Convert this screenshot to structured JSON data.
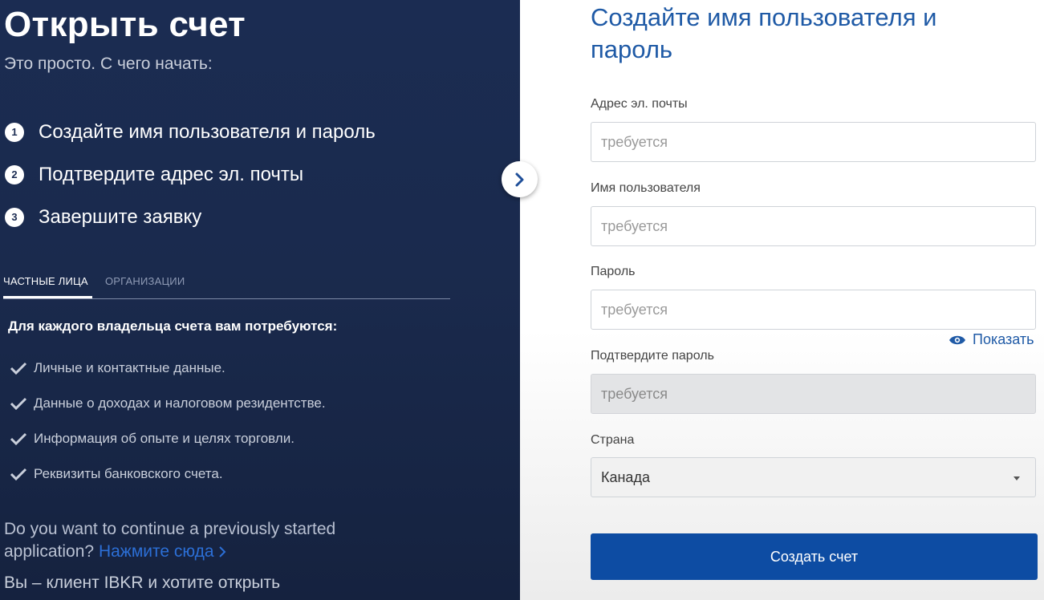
{
  "left": {
    "title": "Открыть счет",
    "subtitle": "Это просто. С чего начать:",
    "steps": [
      {
        "num": "1",
        "label": "Создайте имя пользователя и пароль"
      },
      {
        "num": "2",
        "label": "Подтвердите адрес эл. почты"
      },
      {
        "num": "3",
        "label": "Завершите заявку"
      }
    ],
    "tabs": {
      "individuals": "ЧАСТНЫЕ ЛИЦА",
      "organizations": "ОРГАНИЗАЦИИ"
    },
    "requirements_heading": "Для каждого владельца счета вам потребуются:",
    "requirements": [
      "Личные и контактные данные.",
      "Данные о доходах и налоговом резидентстве.",
      "Информация об опыте и целях торговли.",
      "Реквизиты банковского счета."
    ],
    "continue_text": "Do you want to continue a previously started application?",
    "continue_link": "Нажмите сюда",
    "client_text": "Вы – клиент IBKR и хотите открыть"
  },
  "form": {
    "title": "Создайте имя пользователя и пароль",
    "email_label": "Адрес эл. почты",
    "email_placeholder": "требуется",
    "username_label": "Имя пользователя",
    "username_placeholder": "требуется",
    "password_label": "Пароль",
    "password_placeholder": "требуется",
    "show_password": "Показать",
    "confirm_label": "Подтвердите пароль",
    "confirm_placeholder": "требуется",
    "country_label": "Страна",
    "country_value": "Канада",
    "submit": "Создать счет"
  },
  "colors": {
    "left_bg": "#1b2c52",
    "accent_blue": "#1f5aa6",
    "button_blue": "#0d4ca3",
    "link_blue": "#2c6fd6"
  },
  "icons": {
    "toggle": "chevron-right-icon",
    "check": "checkmark-icon",
    "eye": "eye-icon",
    "caret": "caret-down-icon"
  }
}
